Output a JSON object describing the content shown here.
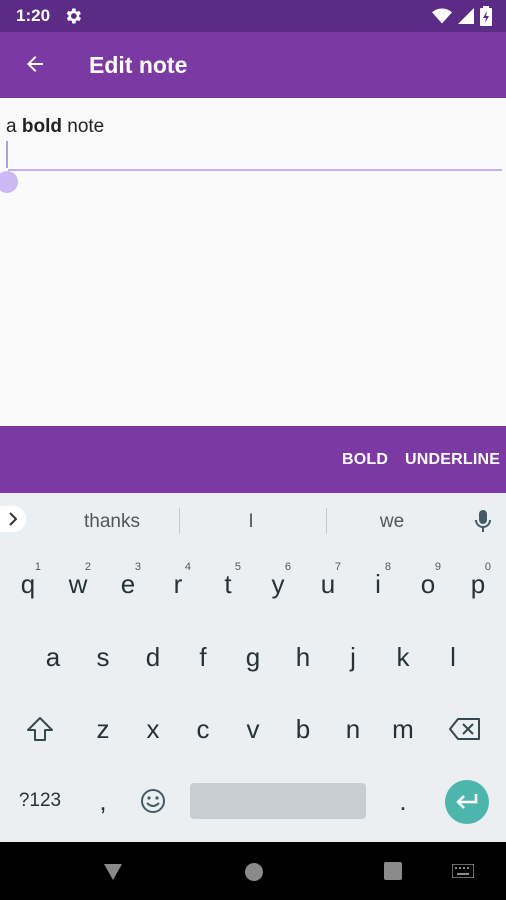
{
  "status": {
    "time": "1:20"
  },
  "appbar": {
    "title": "Edit note"
  },
  "editor": {
    "text_prefix": "a ",
    "text_bold": "bold",
    "text_suffix": " note"
  },
  "format_bar": {
    "bold_label": "BOLD",
    "underline_label": "UNDERLINE"
  },
  "keyboard": {
    "suggestions": [
      "thanks",
      "I",
      "we"
    ],
    "row1": [
      {
        "k": "q",
        "h": "1"
      },
      {
        "k": "w",
        "h": "2"
      },
      {
        "k": "e",
        "h": "3"
      },
      {
        "k": "r",
        "h": "4"
      },
      {
        "k": "t",
        "h": "5"
      },
      {
        "k": "y",
        "h": "6"
      },
      {
        "k": "u",
        "h": "7"
      },
      {
        "k": "i",
        "h": "8"
      },
      {
        "k": "o",
        "h": "9"
      },
      {
        "k": "p",
        "h": "0"
      }
    ],
    "row2": [
      "a",
      "s",
      "d",
      "f",
      "g",
      "h",
      "j",
      "k",
      "l"
    ],
    "row3": [
      "z",
      "x",
      "c",
      "v",
      "b",
      "n",
      "m"
    ],
    "symbols_label": "?123",
    "comma": ",",
    "period": "."
  }
}
